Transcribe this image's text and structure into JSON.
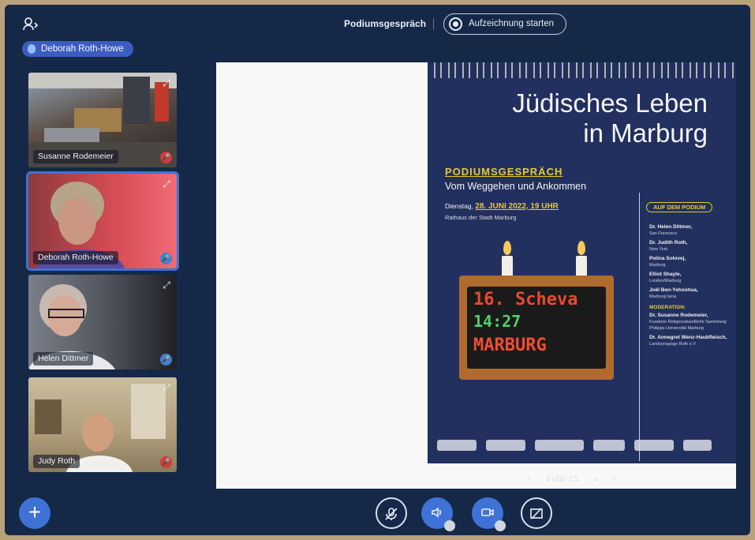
{
  "meeting": {
    "title": "Podiumsgespräch",
    "record_label": "Aufzeichnung starten"
  },
  "presenter": {
    "name": "Deborah Roth-Howe"
  },
  "participants": [
    {
      "name": "Susanne Rodemeier",
      "muted": true
    },
    {
      "name": "Deborah Roth-Howe",
      "muted": false,
      "talking": true
    },
    {
      "name": "Helen Dittmer",
      "muted": false
    },
    {
      "name": "Judy Roth",
      "muted": true
    }
  ],
  "slide": {
    "title_line1": "Jüdisches Leben",
    "title_line2": "in Marburg",
    "subtitle": "PODIUMSGESPRÄCH",
    "tagline": "Vom Weggehen und Ankommen",
    "date_prefix": "Dienstag,",
    "date": "28. JUNI 2022, 19 UHR",
    "place": "Rathaus der Stadt Marburg",
    "podium_label": "AUF DEM PODIUM",
    "panelists": [
      {
        "name": "Dr. Helen Dittmer,",
        "loc": "San Francisco"
      },
      {
        "name": "Dr. Judith Roth,",
        "loc": "New York"
      },
      {
        "name": "Polina Solovej,",
        "loc": "Marburg"
      },
      {
        "name": "Elliot Shayle,",
        "loc": "London/Marburg"
      },
      {
        "name": "Joël Ben-Yehoshua,",
        "loc": "Marburg/Jena"
      }
    ],
    "moderation_label": "MODERATION:",
    "moderators": [
      {
        "name": "Dr. Susanne Rodemeier,",
        "loc": "Kuratorin Religionskundliche Sammlung Philipps-Universität Marburg"
      },
      {
        "name": "Dr. Annegret Wenz-Haubfleisch,",
        "loc": "Landsynagoge Roth e.V."
      }
    ],
    "clock_line1": "16. Scheva",
    "clock_line2": "14:27",
    "clock_line3": "MARBURG",
    "nav_label": "Folie 15"
  },
  "icons": {
    "users": "users-icon",
    "expand": "expand-icon",
    "plus": "plus-icon",
    "mic": "mic-off-icon",
    "audio": "speaker-icon",
    "video": "camera-icon",
    "screen": "screenshare-off-icon"
  },
  "colors": {
    "background": "#152847",
    "accent": "#3e72d6",
    "poster": "#21305f",
    "highlight": "#e7c92e"
  }
}
